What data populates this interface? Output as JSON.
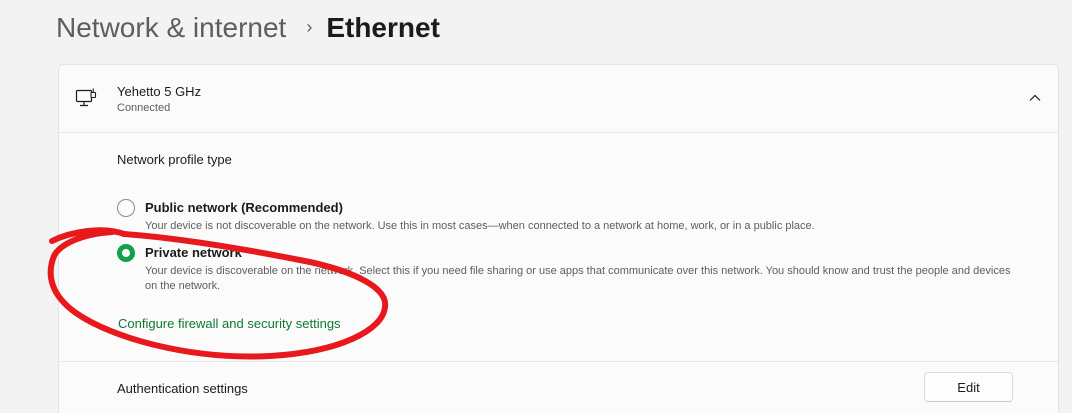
{
  "breadcrumb": {
    "parent": "Network & internet",
    "separator": "›",
    "current": "Ethernet"
  },
  "network": {
    "icon": "ethernet-icon",
    "name": "Yehetto 5 GHz",
    "status": "Connected",
    "expand_icon": "chevron-up-icon"
  },
  "profile": {
    "title": "Network profile type",
    "options": [
      {
        "label": "Public network (Recommended)",
        "description": "Your device is not discoverable on the network. Use this in most cases—when connected to a network at home, work, or in a public place.",
        "selected": false
      },
      {
        "label": "Private network",
        "description": "Your device is discoverable on the network. Select this if you need file sharing or use apps that communicate over this network. You should know and trust the people and devices on the network.",
        "selected": true
      }
    ],
    "firewall_link": "Configure firewall and security settings"
  },
  "authentication": {
    "label": "Authentication settings",
    "edit_button": "Edit"
  },
  "colors": {
    "accent": "#12a14a",
    "link": "#0d7a2e",
    "annotation": "#e8191c"
  }
}
